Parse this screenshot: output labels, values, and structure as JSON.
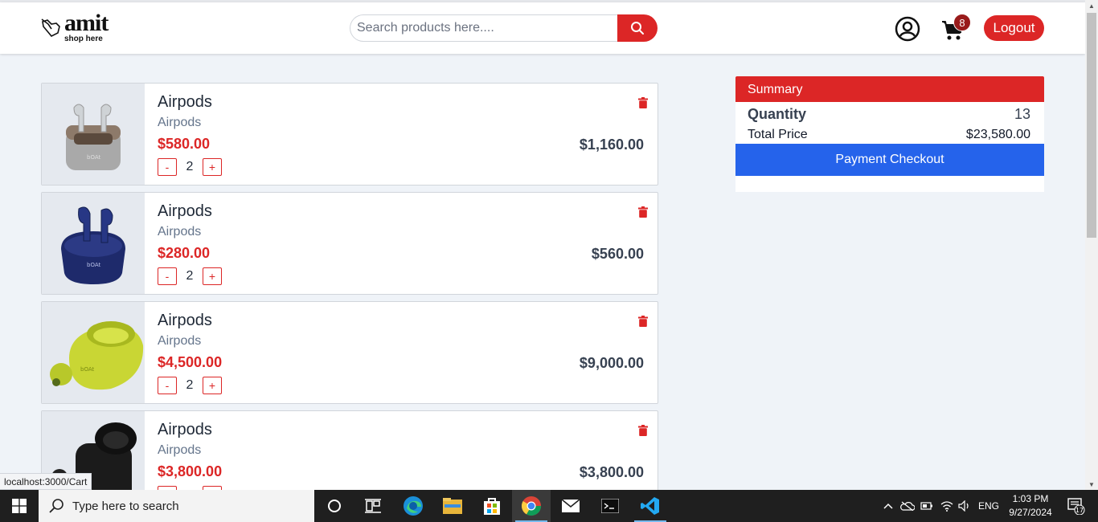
{
  "header": {
    "logo_word": "amit",
    "logo_tagline": "shop here",
    "search_placeholder": "Search products here....",
    "cart_count": "8",
    "logout_label": "Logout"
  },
  "cart": {
    "items": [
      {
        "name": "Airpods",
        "subtitle": "Airpods",
        "price": "$580.00",
        "qty": "2",
        "total": "$1,160.00",
        "image": "white-earbuds"
      },
      {
        "name": "Airpods",
        "subtitle": "Airpods",
        "price": "$280.00",
        "qty": "2",
        "total": "$560.00",
        "image": "navy-earbuds"
      },
      {
        "name": "Airpods",
        "subtitle": "Airpods",
        "price": "$4,500.00",
        "qty": "2",
        "total": "$9,000.00",
        "image": "lime-earbuds"
      },
      {
        "name": "Airpods",
        "subtitle": "Airpods",
        "price": "$3,800.00",
        "qty": "",
        "total": "$3,800.00",
        "image": "black-earbuds"
      }
    ],
    "minus_label": "-",
    "plus_label": "+"
  },
  "summary": {
    "title": "Summary",
    "quantity_label": "Quantity",
    "quantity_value": "13",
    "total_label": "Total Price",
    "total_value": "$23,580.00",
    "checkout_label": "Payment Checkout"
  },
  "status_url": "localhost:3000/Cart",
  "taskbar": {
    "search_text": "Type here to search",
    "language": "ENG",
    "time": "1:03 PM",
    "date": "9/27/2024",
    "notification_count": "17"
  },
  "colors": {
    "accent_red": "#dc2626",
    "checkout_blue": "#2563eb",
    "badge_red": "#991b1b"
  },
  "icons": [
    "hand-pointer-icon",
    "search-icon",
    "user-circle-icon",
    "cart-icon",
    "trash-icon",
    "windows-icon",
    "cortana-icon",
    "task-view-icon",
    "edge-icon",
    "file-explorer-icon",
    "store-icon",
    "chrome-icon",
    "mail-icon",
    "terminal-icon",
    "vscode-icon"
  ]
}
